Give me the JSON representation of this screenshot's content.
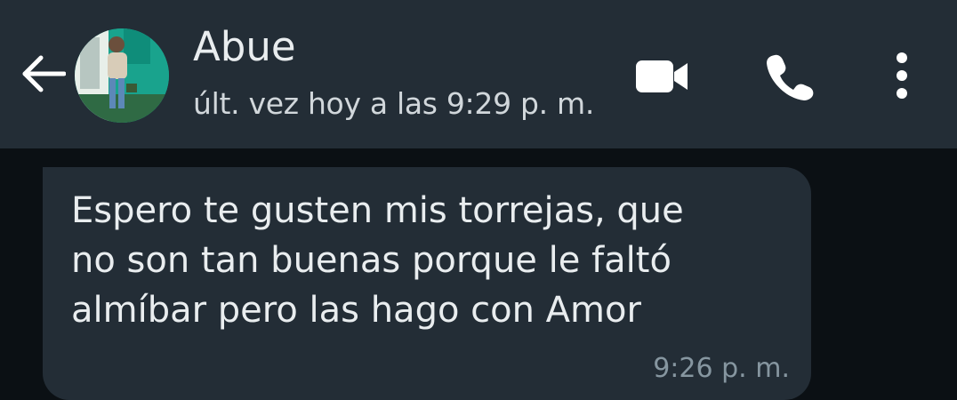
{
  "header": {
    "contact_name": "Abue",
    "last_seen": "últ. vez hoy a las 9:29 p. m.",
    "icons": {
      "back": "arrow-left-icon",
      "video": "video-camera-icon",
      "call": "phone-icon",
      "menu": "more-vertical-icon"
    }
  },
  "messages": [
    {
      "text": "Espero te gusten mis torrejas, que\nno son tan buenas porque le faltó\nalmíbar pero las hago con Amor",
      "time": "9:26 p. m.",
      "direction": "incoming"
    }
  ],
  "colors": {
    "header_bg": "#232d36",
    "chat_bg": "#0b1014",
    "bubble_bg": "#232d36",
    "text": "#e9edef",
    "meta_text": "#8696a0"
  }
}
